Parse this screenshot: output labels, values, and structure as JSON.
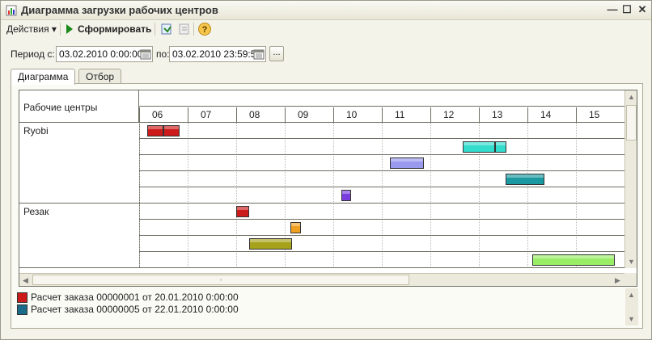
{
  "window": {
    "title": "Диаграмма загрузки рабочих центров",
    "minimize_glyph": "—",
    "maximize_glyph": "☐",
    "close_glyph": "✕"
  },
  "toolbar": {
    "actions_label": "Действия ▾",
    "run_label": "Сформировать",
    "icons": [
      "export-icon",
      "import-icon",
      "help-icon"
    ]
  },
  "period": {
    "from_label": "Период с:",
    "from_value": "03.02.2010  0:00:00",
    "to_label": "по:",
    "to_value": "03.02.2010 23:59:59",
    "dots_label": "..."
  },
  "tabs": [
    {
      "label": "Диаграмма",
      "active": true
    },
    {
      "label": "Отбор",
      "active": false
    }
  ],
  "gantt": {
    "work_centers_header": "Рабочие центры",
    "hours": [
      "06",
      "07",
      "08",
      "09",
      "10",
      "11",
      "12",
      "13",
      "14",
      "15"
    ],
    "groups": [
      {
        "name": "Ryobi",
        "rows": [
          {
            "bars": [
              {
                "start": 6.17,
                "end": 6.5,
                "color": "#cc1a1a"
              },
              {
                "start": 6.5,
                "end": 6.84,
                "color": "#cc1a1a"
              }
            ]
          },
          {
            "bars": [
              {
                "start": 12.67,
                "end": 13.34,
                "color": "#33dccc"
              },
              {
                "start": 13.34,
                "end": 13.57,
                "color": "#33dccc"
              }
            ]
          },
          {
            "bars": [
              {
                "start": 11.17,
                "end": 11.87,
                "color": "#9999ee"
              }
            ]
          },
          {
            "bars": [
              {
                "start": 13.55,
                "end": 14.35,
                "color": "#1a9aa0"
              }
            ]
          },
          {
            "bars": [
              {
                "start": 10.17,
                "end": 10.37,
                "color": "#7a3ee0"
              }
            ]
          }
        ]
      },
      {
        "name": "Резак",
        "rows": [
          {
            "bars": [
              {
                "start": 8.0,
                "end": 8.27,
                "color": "#cc1a1a"
              }
            ]
          },
          {
            "bars": [
              {
                "start": 9.12,
                "end": 9.34,
                "color": "#f0a020"
              }
            ]
          },
          {
            "bars": [
              {
                "start": 8.27,
                "end": 9.15,
                "color": "#a6a21a"
              }
            ]
          },
          {
            "bars": [
              {
                "start": 14.1,
                "end": 15.8,
                "color": "#99ee66"
              }
            ]
          }
        ]
      }
    ]
  },
  "legend": [
    {
      "color": "#cc1a1a",
      "text": "Расчет заказа 00000001 от 20.01.2010 0:00:00"
    },
    {
      "color": "#1a6a8a",
      "text": "Расчет заказа 00000005 от 22.01.2010 0:00:00"
    }
  ]
}
